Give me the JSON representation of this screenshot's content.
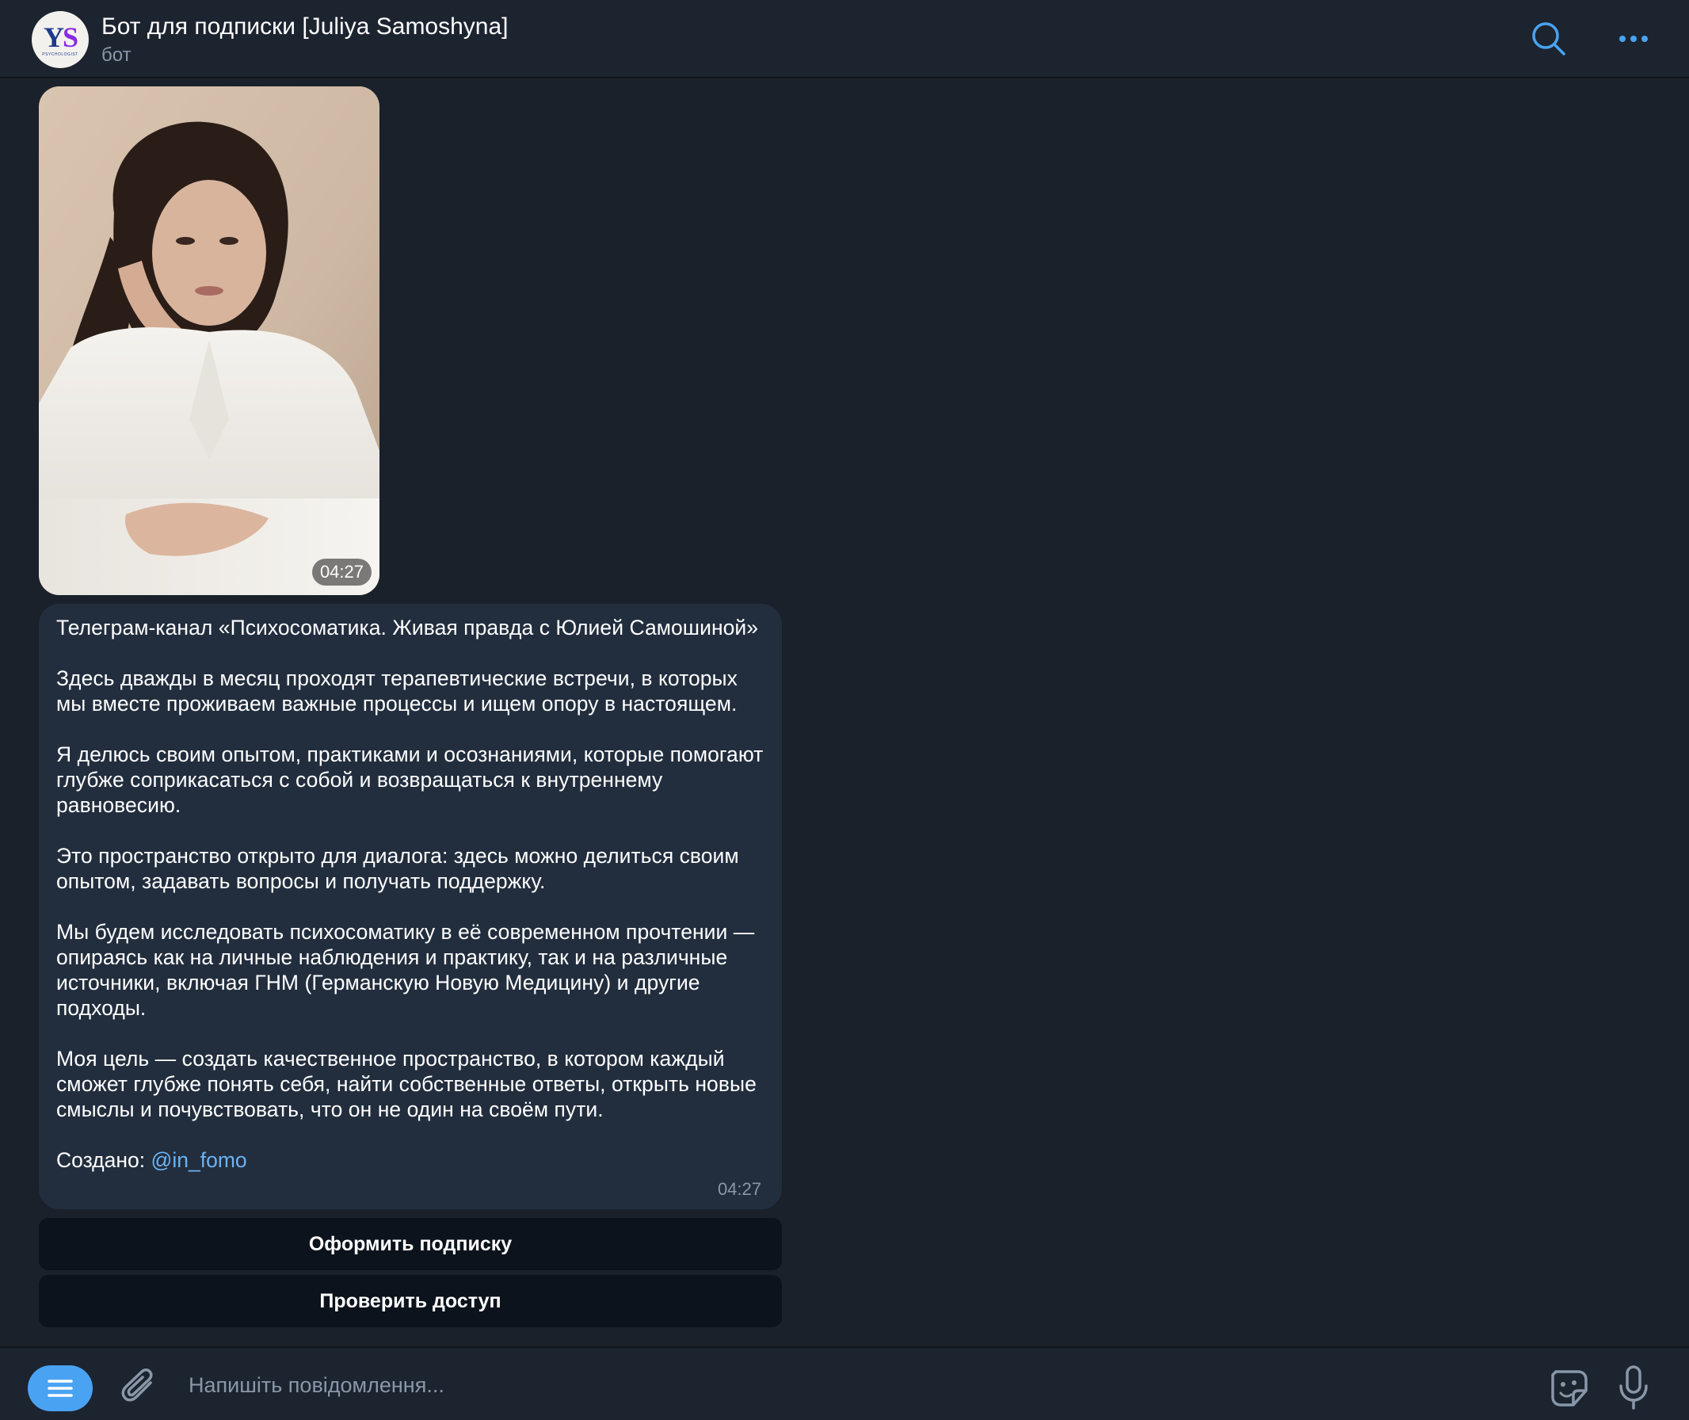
{
  "header": {
    "title": "Бот для подписки [Juliya Samoshyna]",
    "subtitle": "бот",
    "avatar_logo_y": "Y",
    "avatar_logo_s": "S",
    "avatar_sub": "PSYCHOLOGIST",
    "search_icon": "search-icon",
    "more_icon": "more-dots-icon"
  },
  "video_message": {
    "duration": "04:27"
  },
  "text_message": {
    "paragraphs": [
      "Телеграм-канал «Психосоматика. Живая правда с Юлией Самошиной»",
      "Здесь дважды в месяц проходят терапевтические встречи, в которых мы вместе проживаем важные процессы и ищем опору в настоящем.",
      "Я делюсь своим опытом, практиками и осознаниями, которые помогают глубже соприкасаться с собой и возвращаться к внутреннему равновесию.",
      "Это пространство открыто для диалога: здесь можно делиться своим опытом, задавать вопросы и получать поддержку.",
      "Мы будем исследовать психосоматику в её современном прочтении — опираясь как на личные наблюдения и практику, так и на различные источники, включая ГНМ (Германскую Новую Медицину) и другие подходы.",
      "Моя цель — создать качественное пространство, в котором каждый сможет глубже понять себя, найти собственные ответы, открыть новые смыслы и почувствовать, что он не один на своём пути."
    ],
    "credit_label": "Создано: ",
    "credit_link": "@in_fomo",
    "time": "04:27"
  },
  "inline_keyboard": {
    "subscribe_label": "Оформить подписку",
    "check_access_label": "Проверить доступ"
  },
  "composer": {
    "placeholder": "Напишіть повідомлення...",
    "menu_icon": "menu-lines-icon",
    "attach_icon": "paperclip-icon",
    "sticker_icon": "sticker-icon",
    "mic_icon": "microphone-icon"
  },
  "colors": {
    "background": "#1a212b",
    "header": "#1c2430",
    "bubble": "#222e3e",
    "accent": "#4aa3f2",
    "link": "#6db2f2",
    "muted_text": "#8a97a8",
    "button": "#0d131c"
  }
}
